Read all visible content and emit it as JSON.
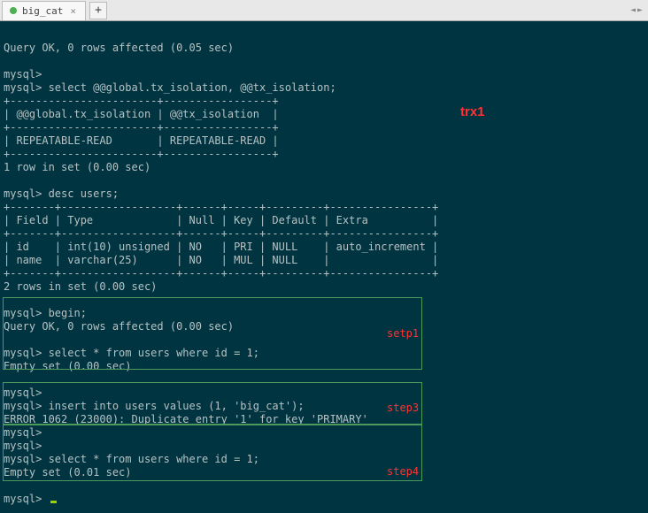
{
  "tabbar": {
    "tab_title": "big_cat",
    "close": "×",
    "add": "+"
  },
  "annotation": {
    "trx1": "trx1",
    "step1": "setp1",
    "step3": "step3",
    "step4": "step4"
  },
  "term": {
    "l01": "Query OK, 0 rows affected (0.05 sec)",
    "l02": "",
    "l03": "mysql>",
    "l04": "mysql> select @@global.tx_isolation, @@tx_isolation;",
    "l05": "+-----------------------+-----------------+",
    "l06": "| @@global.tx_isolation | @@tx_isolation  |",
    "l07": "+-----------------------+-----------------+",
    "l08": "| REPEATABLE-READ       | REPEATABLE-READ |",
    "l09": "+-----------------------+-----------------+",
    "l10": "1 row in set (0.00 sec)",
    "l11": "",
    "l12": "mysql> desc users;",
    "l13": "+-------+------------------+------+-----+---------+----------------+",
    "l14": "| Field | Type             | Null | Key | Default | Extra          |",
    "l15": "+-------+------------------+------+-----+---------+----------------+",
    "l16": "| id    | int(10) unsigned | NO   | PRI | NULL    | auto_increment |",
    "l17": "| name  | varchar(25)      | NO   | MUL | NULL    |                |",
    "l18": "+-------+------------------+------+-----+---------+----------------+",
    "l19": "2 rows in set (0.00 sec)",
    "l20": "",
    "l21": "mysql> begin;",
    "l22": "Query OK, 0 rows affected (0.00 sec)",
    "l23": "",
    "l24": "mysql> select * from users where id = 1;",
    "l25": "Empty set (0.00 sec)",
    "l26": "",
    "l27": "mysql>",
    "l28": "mysql> insert into users values (1, 'big_cat');",
    "l29": "ERROR 1062 (23000): Duplicate entry '1' for key 'PRIMARY'",
    "l30": "mysql>",
    "l31": "mysql>",
    "l32": "mysql> select * from users where id = 1;",
    "l33": "Empty set (0.01 sec)",
    "l34": "",
    "l35": "mysql> "
  }
}
